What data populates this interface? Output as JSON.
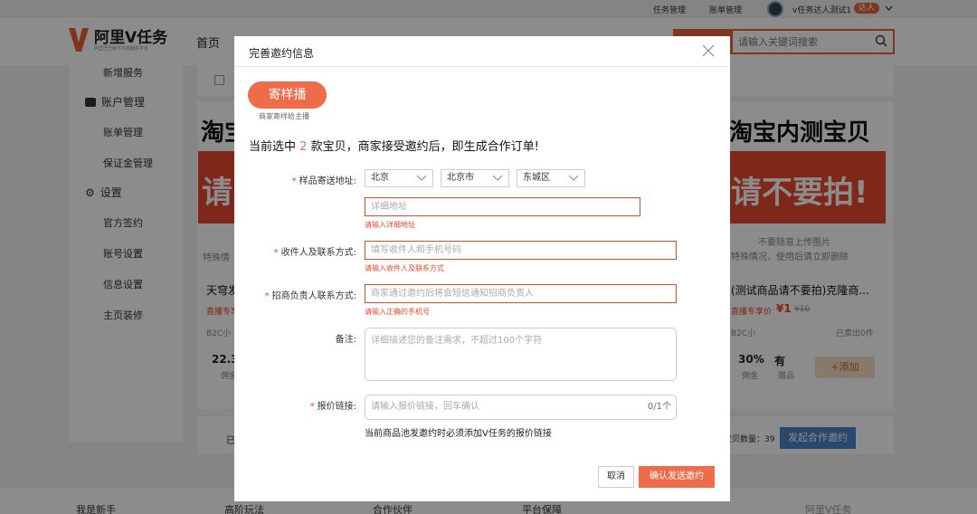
{
  "topbar": {
    "task_mgmt": "任务管理",
    "bill_mgmt": "账单管理",
    "username": "v任务达人测试1",
    "role_badge": "达人"
  },
  "header": {
    "logo_text": "阿里V任务",
    "logo_sub": "阿里巴巴旗下内容服务平台",
    "nav_home": "首页",
    "search_placeholder": "请输入关键词搜索"
  },
  "sidebar": {
    "item_new_service": "新增服务",
    "section_account": "账户管理",
    "item_bill": "账单管理",
    "item_deposit": "保证金管理",
    "section_settings": "设置",
    "item_official_sign": "官方签约",
    "item_account_settings": "账号设置",
    "item_info_settings": "信息设置",
    "item_homepage": "主页装修"
  },
  "background": {
    "banner_left_title": "淘宝",
    "banner_left_red": "请",
    "banner_right_title": "淘宝内测宝贝",
    "banner_right_red": "请不要拍!",
    "left_note": "特殊情",
    "right_note_1": "不要随意上传图片",
    "right_note_2": "特殊情况，使用后请立即删除",
    "left_product": "天穹发",
    "left_tag": "直播专享",
    "left_shop": "B2C小",
    "left_price": "22.3",
    "left_price_label": "佣金",
    "right_product": "(测试商品请不要拍)克隆商...",
    "right_tag": "直播专享价",
    "right_price": "¥1",
    "right_old_price": "¥10",
    "right_shop": "B2C小",
    "right_sold": "已卖出0件",
    "right_commission": "30%",
    "right_commission_label": "佣金",
    "right_gift": "有",
    "right_gift_label": "赠品",
    "add_button": "+添加",
    "bottom_left": "已",
    "bottom_count": "宝贝数量：39",
    "invite_button": "发起合作邀约"
  },
  "footer": {
    "col1": "我是新手",
    "col2": "高阶玩法",
    "col3": "合作伙伴",
    "col4": "平台保障",
    "col5_logo": "阿里V任务"
  },
  "modal": {
    "title": "完善邀约信息",
    "pill_label": "寄样播",
    "pill_sub": "商家寄样给主播",
    "headline_pre": "当前选中",
    "headline_count": "2",
    "headline_post": "款宝贝，商家接受邀约后，即生成合作订单!",
    "addr_label": "样品寄送地址:",
    "province": "北京",
    "city": "北京市",
    "district": "东城区",
    "detail_addr_placeholder": "详细地址",
    "detail_addr_error": "请输入详细地址",
    "receiver_label": "收件人及联系方式:",
    "receiver_placeholder": "填写收件人和手机号码",
    "receiver_error": "请输入收件人及联系方式",
    "merchant_label": "招商负责人联系方式:",
    "merchant_placeholder": "商家通过邀约后将会短信通知招商负责人",
    "merchant_error": "请输入正确的手机号",
    "remark_label": "备注:",
    "remark_placeholder": "详细描述您的备注需求，不超过100个字符",
    "link_label": "报价链接:",
    "link_placeholder": "请输入报价链接，回车确认",
    "link_count": "0/1个",
    "link_hint": "当前商品池发邀约时必须添加V任务的报价链接",
    "cancel": "取消",
    "confirm": "确认发送邀约"
  },
  "colors": {
    "accent": "#ef6c4a",
    "error": "#e8482c",
    "blue": "#4e84c4"
  }
}
